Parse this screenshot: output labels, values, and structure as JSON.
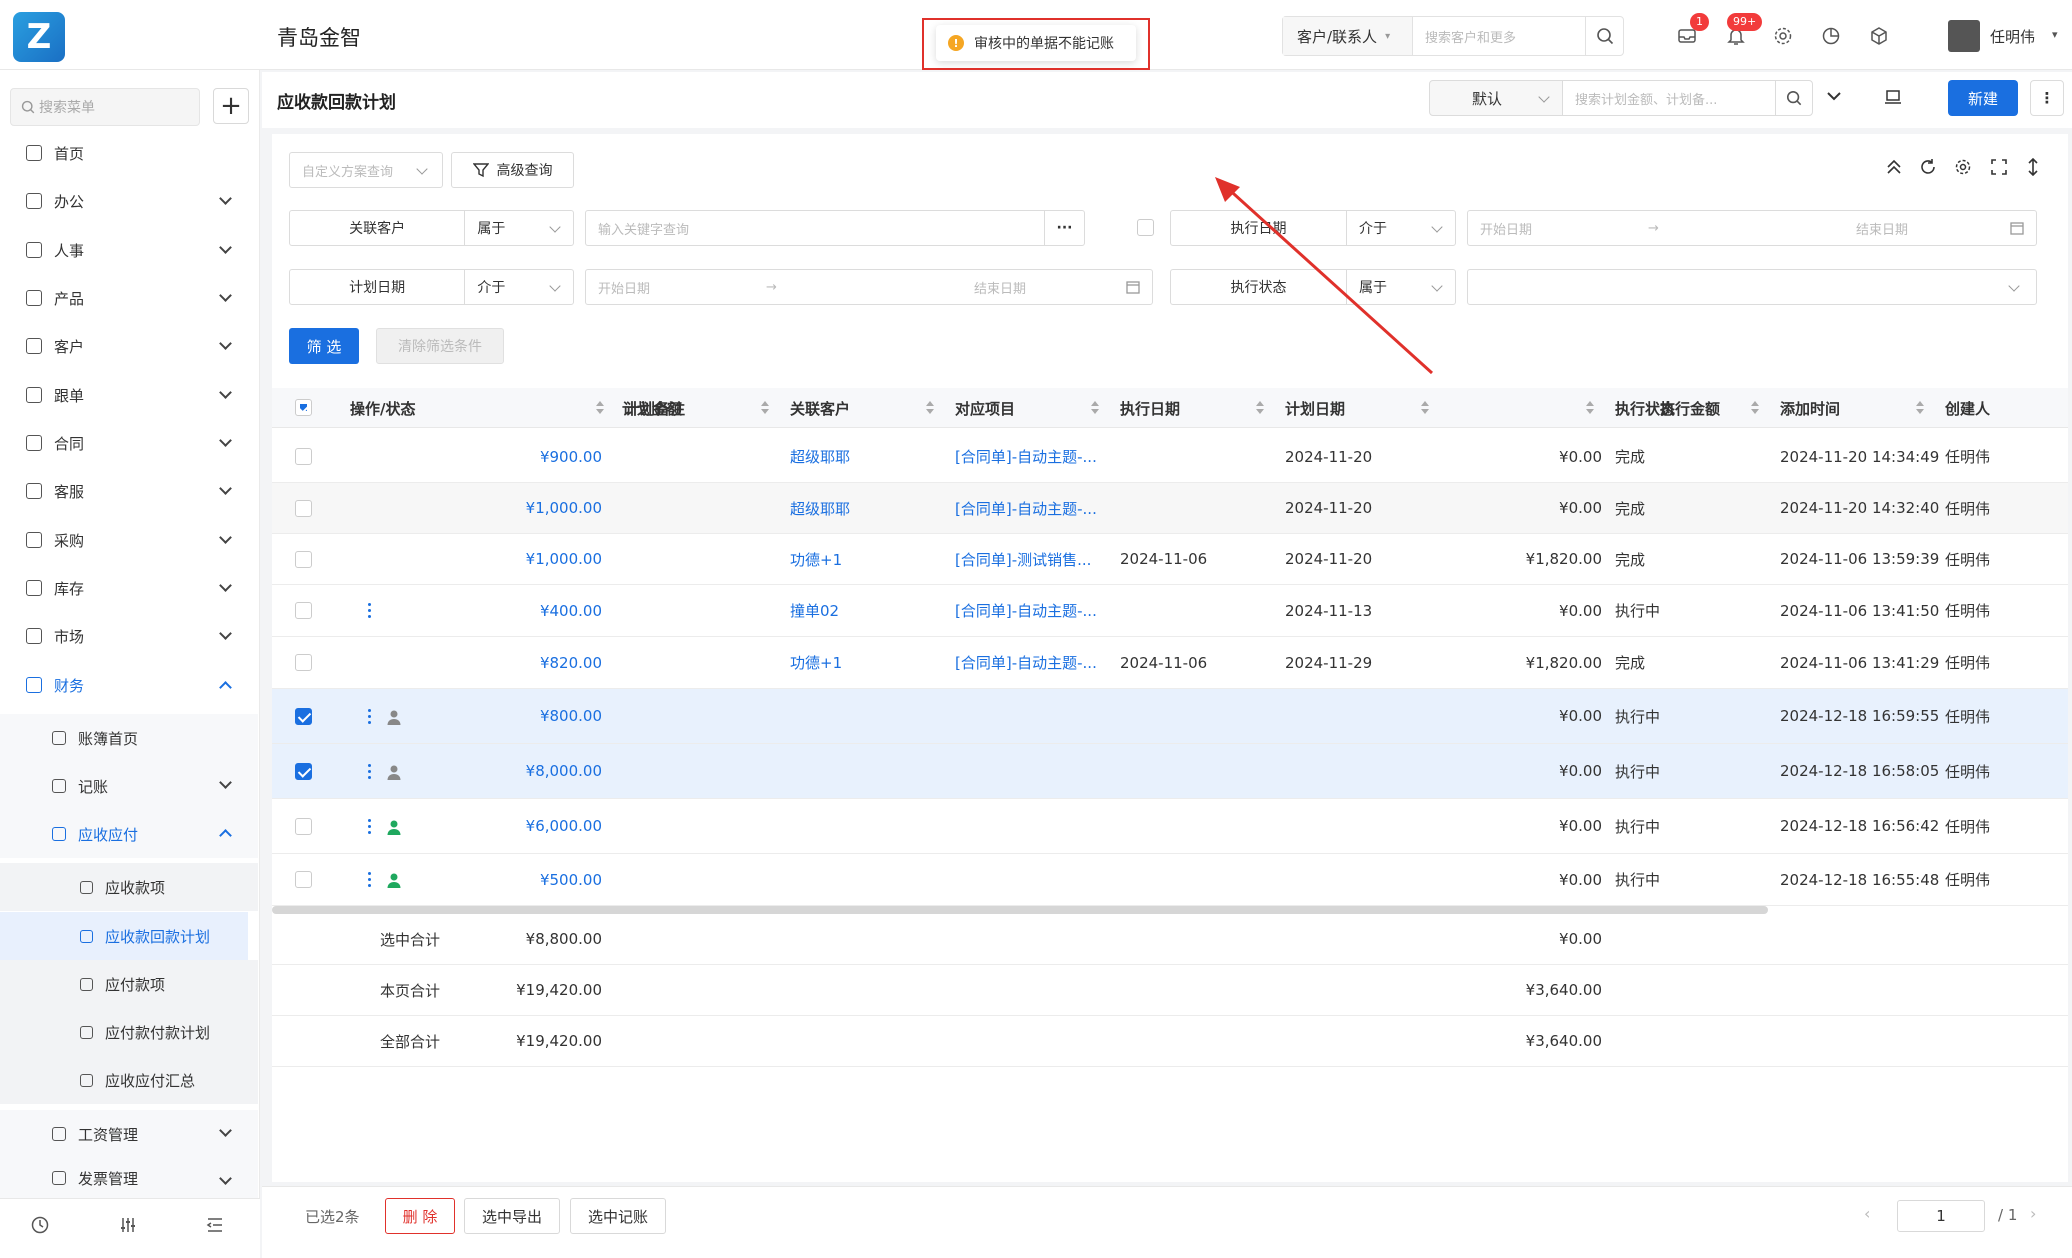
{
  "app": {
    "logo_text": "Z",
    "company": "青岛金智",
    "toast": "审核中的单据不能记账"
  },
  "global_search": {
    "type": "客户/联系人",
    "placeholder": "搜索客户和更多"
  },
  "notifications": {
    "msg_badge": "1",
    "bell_badge": "99+"
  },
  "user": {
    "name": "任明伟"
  },
  "sidebar": {
    "search_placeholder": "搜索菜单",
    "items": [
      "首页",
      "办公",
      "人事",
      "产品",
      "客户",
      "跟单",
      "合同",
      "客服",
      "采购",
      "库存",
      "市场",
      "财务"
    ],
    "finance_sub": [
      "账簿首页",
      "记账",
      "应收应付"
    ],
    "arap_sub": [
      "应收款项",
      "应收款回款计划",
      "应付款项",
      "应付款付款计划",
      "应收应付汇总"
    ],
    "more": [
      "工资管理",
      "发票管理"
    ]
  },
  "page": {
    "title": "应收款回款计划",
    "view": "默认",
    "search_placeholder": "搜索计划金额、计划备...",
    "new_label": "新建"
  },
  "filters": {
    "custom_query": "自定义方案查询",
    "advanced": "高级查询",
    "customer_label": "关联客户",
    "customer_op": "属于",
    "customer_ph": "输入关键字查询",
    "exec_date_label": "执行日期",
    "exec_date_op": "介于",
    "plan_date_label": "计划日期",
    "plan_date_op": "介于",
    "start_ph": "开始日期",
    "end_ph": "结束日期",
    "exec_status_label": "执行状态",
    "exec_status_op": "属于",
    "filter_btn": "筛 选",
    "clear_btn": "清除筛选条件"
  },
  "table": {
    "columns": [
      "操作/状态",
      "计划金额",
      "计划备注",
      "关联客户",
      "对应项目",
      "执行日期",
      "计划日期",
      "执行金额",
      "执行状态",
      "添加时间",
      "创建人"
    ],
    "rows": [
      {
        "amount": "¥900.00",
        "customer": "超级耶耶",
        "project": "[合同单]-自动主题-...",
        "exec_date": "",
        "plan_date": "2024-11-20",
        "exec_amount": "¥0.00",
        "status": "完成",
        "added": "2024-11-20 14:34:49",
        "creator": "任明伟"
      },
      {
        "amount": "¥1,000.00",
        "customer": "超级耶耶",
        "project": "[合同单]-自动主题-...",
        "exec_date": "",
        "plan_date": "2024-11-20",
        "exec_amount": "¥0.00",
        "status": "完成",
        "added": "2024-11-20 14:32:40",
        "creator": "任明伟"
      },
      {
        "amount": "¥1,000.00",
        "customer": "功德+1",
        "project": "[合同单]-测试销售...",
        "exec_date": "2024-11-06",
        "plan_date": "2024-11-20",
        "exec_amount": "¥1,820.00",
        "status": "完成",
        "added": "2024-11-06 13:59:39",
        "creator": "任明伟"
      },
      {
        "amount": "¥400.00",
        "customer": "撞单02",
        "project": "[合同单]-自动主题-...",
        "exec_date": "",
        "plan_date": "2024-11-13",
        "exec_amount": "¥0.00",
        "status": "执行中",
        "added": "2024-11-06 13:41:50",
        "creator": "任明伟"
      },
      {
        "amount": "¥820.00",
        "customer": "功德+1",
        "project": "[合同单]-自动主题-...",
        "exec_date": "2024-11-06",
        "plan_date": "2024-11-29",
        "exec_amount": "¥1,820.00",
        "status": "完成",
        "added": "2024-11-06 13:41:29",
        "creator": "任明伟"
      },
      {
        "amount": "¥800.00",
        "customer": "",
        "project": "",
        "exec_date": "",
        "plan_date": "",
        "exec_amount": "¥0.00",
        "status": "执行中",
        "added": "2024-12-18 16:59:55",
        "creator": "任明伟"
      },
      {
        "amount": "¥8,000.00",
        "customer": "",
        "project": "",
        "exec_date": "",
        "plan_date": "",
        "exec_amount": "¥0.00",
        "status": "执行中",
        "added": "2024-12-18 16:58:05",
        "creator": "任明伟"
      },
      {
        "amount": "¥6,000.00",
        "customer": "",
        "project": "",
        "exec_date": "",
        "plan_date": "",
        "exec_amount": "¥0.00",
        "status": "执行中",
        "added": "2024-12-18 16:56:42",
        "creator": "任明伟"
      },
      {
        "amount": "¥500.00",
        "customer": "",
        "project": "",
        "exec_date": "",
        "plan_date": "",
        "exec_amount": "¥0.00",
        "status": "执行中",
        "added": "2024-12-18 16:55:48",
        "creator": "任明伟"
      }
    ],
    "summary": [
      {
        "label": "选中合计",
        "amount": "¥8,800.00",
        "exec": "¥0.00"
      },
      {
        "label": "本页合计",
        "amount": "¥19,420.00",
        "exec": "¥3,640.00"
      },
      {
        "label": "全部合计",
        "amount": "¥19,420.00",
        "exec": "¥3,640.00"
      }
    ]
  },
  "footer": {
    "selected": "已选2条",
    "delete": "删 除",
    "export": "选中导出",
    "record": "选中记账",
    "page": "1",
    "total_pages": "/ 1"
  }
}
